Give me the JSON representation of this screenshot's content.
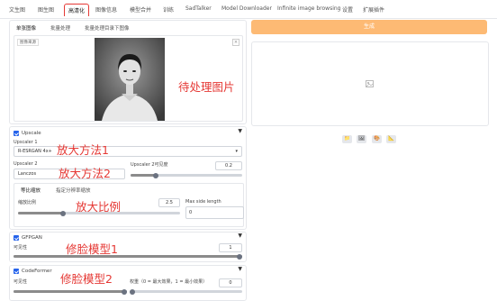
{
  "tabs": [
    "文生图",
    "图生图",
    "高清化",
    "图像信息",
    "模型合并",
    "训练",
    "SadTalker",
    "Model Downloader",
    "Infinite image browsing",
    "设置",
    "扩展插件"
  ],
  "active_tab": "高清化",
  "subtabs": [
    "单张图像",
    "批量处理",
    "批量处理目录下图像"
  ],
  "active_subtab": "单张图像",
  "image_panel": {
    "upload_label": "图像来源",
    "annotation": "待处理图片"
  },
  "generate_label": "生成",
  "upscale": {
    "title": "Upscale",
    "upscaler1_label": "Upscaler 1",
    "upscaler1_value": "R-ESRGAN 4x+",
    "upscaler1_anno": "放大方法1",
    "upscaler2_label": "Upscaler 2",
    "upscaler2_value": "Lanczos",
    "upscaler2_anno": "放大方法2",
    "visibility_label": "Upscaler 2可见度",
    "visibility_value": "0.2",
    "resize_tab": "等比缩放",
    "target_tab": "指定分辨率缩放",
    "scale_label": "缩放比例",
    "scale_value": "2.5",
    "scale_anno": "放大比例",
    "max_side_label": "Max side length",
    "max_side_value": "0"
  },
  "gfpgan": {
    "title": "GFPGAN",
    "visibility_label": "可见性",
    "visibility_value": "1",
    "anno": "修脸模型1"
  },
  "codeformer": {
    "title": "CodeFormer",
    "visibility_label": "可见性",
    "weight_label": "权重（0 = 最大效果，1 = 最小效果）",
    "weight_value": "0",
    "anno": "修脸模型2"
  },
  "output_icons": [
    "folder-icon",
    "image-icon",
    "palette-icon",
    "extras-icon"
  ]
}
